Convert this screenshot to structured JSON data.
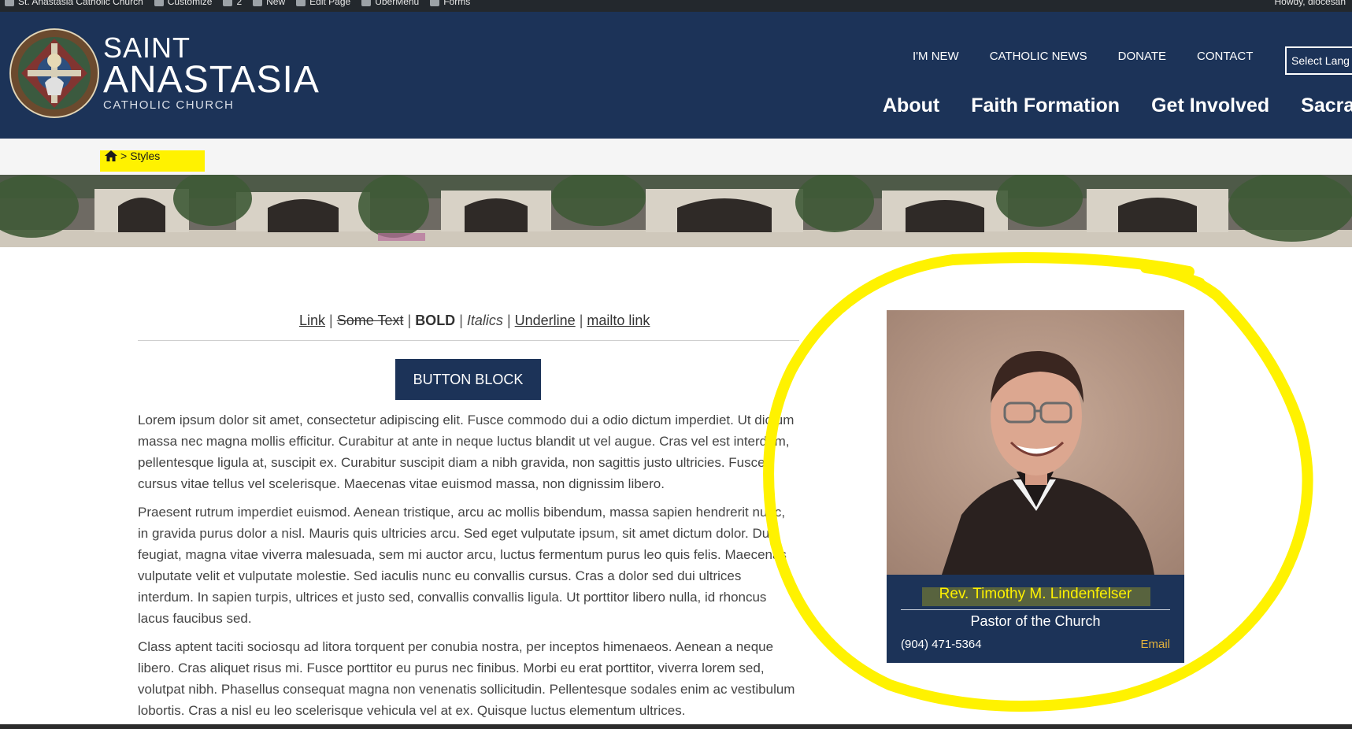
{
  "admin_bar": {
    "items": [
      {
        "label": "St. Anastasia Catholic Church",
        "icon": "wordpress-icon"
      },
      {
        "label": "Customize",
        "icon": "brush-icon"
      },
      {
        "label": "2",
        "icon": "updates-icon"
      },
      {
        "label": "New",
        "icon": "plus-icon"
      },
      {
        "label": "Edit Page",
        "icon": "pencil-icon"
      },
      {
        "label": "UberMenu",
        "icon": "gear-icon"
      },
      {
        "label": "Forms",
        "icon": "forms-icon"
      }
    ],
    "howdy": "Howdy, diocesan"
  },
  "header": {
    "logo": {
      "line1": "SAINT",
      "line2": "ANASTASIA",
      "line3": "CATHOLIC CHURCH"
    },
    "top_nav": [
      "I'M NEW",
      "CATHOLIC NEWS",
      "DONATE",
      "CONTACT"
    ],
    "language_select": "Select Lang",
    "main_nav": [
      "About",
      "Faith Formation",
      "Get Involved",
      "Sacramen"
    ],
    "colors": {
      "header_bg": "#1c3358",
      "accent_highlight": "#fff200"
    }
  },
  "breadcrumb": {
    "home_icon": "home-icon",
    "separator": ">",
    "current": "Styles"
  },
  "content": {
    "format_links": {
      "link": "Link",
      "strike": "Some Text",
      "bold": "BOLD",
      "italic": "Italics",
      "underline": "Underline",
      "mailto": "mailto link",
      "separator": "|"
    },
    "button_label": "BUTTON BLOCK",
    "paragraphs": [
      "Lorem ipsum dolor sit amet, consectetur adipiscing elit. Fusce commodo dui a odio dictum imperdiet. Ut dictum massa nec magna mollis efficitur. Curabitur at ante in neque luctus blandit ut vel augue. Cras vel est interdum, pellentesque ligula at, suscipit ex. Curabitur suscipit diam a nibh gravida, non sagittis justo ultricies. Fusce cursus vitae tellus vel scelerisque. Maecenas vitae euismod massa, non dignissim libero.",
      "Praesent rutrum imperdiet euismod. Aenean tristique, arcu ac mollis bibendum, massa sapien hendrerit nunc, in gravida purus dolor a nisl. Mauris quis ultricies arcu. Sed eget vulputate ipsum, sit amet dictum dolor. Duis feugiat, magna vitae viverra malesuada, sem mi auctor arcu, luctus fermentum purus leo quis felis. Maecenas vulputate velit et vulputate molestie. Sed iaculis nunc eu convallis cursus. Cras a dolor sed dui ultrices interdum. In sapien turpis, ultrices et justo sed, convallis convallis ligula. Ut porttitor libero nulla, id rhoncus lacus faucibus sed.",
      "Class aptent taciti sociosqu ad litora torquent per conubia nostra, per inceptos himenaeos. Aenean a neque libero. Cras aliquet risus mi. Fusce porttitor eu purus nec finibus. Morbi eu erat porttitor, viverra lorem sed, volutpat nibh. Phasellus consequat magna non venenatis sollicitudin. Pellentesque sodales enim ac vestibulum lobortis. Cras a nisl eu leo scelerisque vehicula vel at ex. Quisque luctus elementum ultrices."
    ]
  },
  "staff_card": {
    "name": "Rev. Timothy M. Lindenfelser",
    "role": "Pastor of the Church",
    "phone": "(904) 471-5364",
    "email_label": "Email"
  }
}
